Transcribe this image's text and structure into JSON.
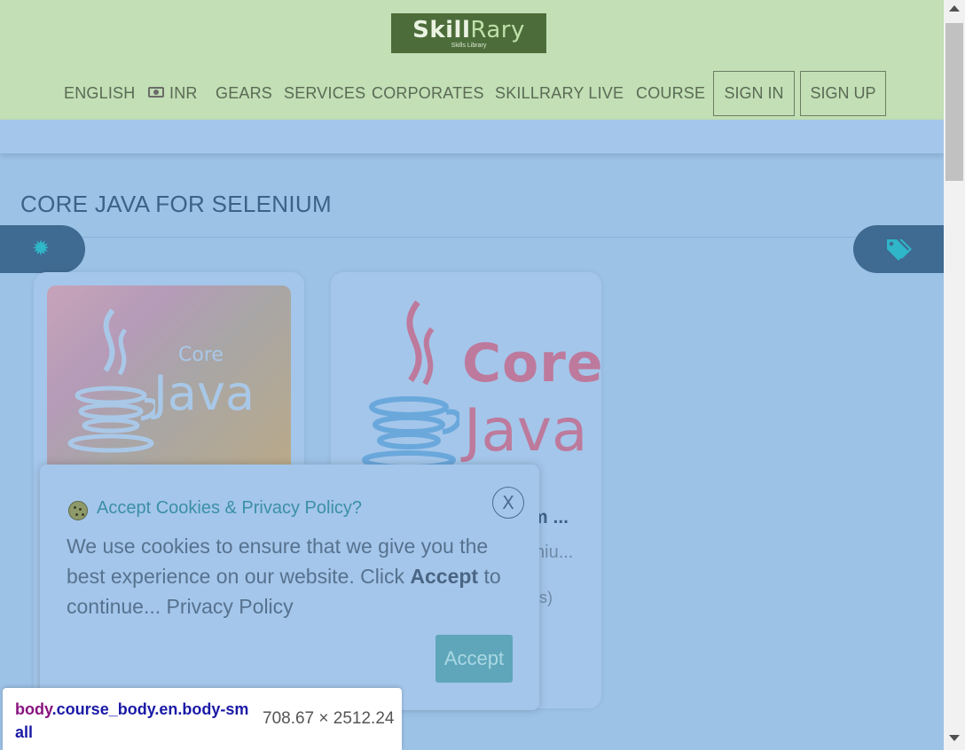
{
  "header": {
    "logo": {
      "main_a": "Skill",
      "main_b": "Rary",
      "sub": "Skills Library"
    },
    "nav": {
      "english": "ENGLISH",
      "currency": "INR",
      "gears": "GEARS",
      "services": "SERVICES",
      "corporates": "CORPORATES",
      "live": "SKILLRARY LIVE",
      "course": "COURSE",
      "signin": "SIGN IN",
      "signup": "SIGN UP"
    }
  },
  "main": {
    "title": "CORE JAVA FOR SELENIUM",
    "cards": [
      {
        "thumb_top": "Core",
        "thumb_bottom": "Java"
      },
      {
        "thumb_top": "Core",
        "thumb_bottom": "Java",
        "heading_fragment": "m ...",
        "subtitle_fragment": "niu...",
        "meta_fragment": "ts)"
      }
    ]
  },
  "cookie": {
    "close": "X",
    "title": "Accept Cookies & Privacy Policy?",
    "text_1": "We use cookies to ensure that we give you the best experience on our website. Click ",
    "text_bold": "Accept",
    "text_2": " to continue... Privacy Policy",
    "accept_label": "Accept"
  },
  "tooltip": {
    "tag": "body",
    "classes": ".course_body.en.body-small",
    "size": "708.67 × 2512.24"
  },
  "colors": {
    "header_bg": "#c2dfb5",
    "overlay_bg": "#9cc2e6",
    "accent": "#3f6a91",
    "accept_button": "#5fa6ba"
  }
}
